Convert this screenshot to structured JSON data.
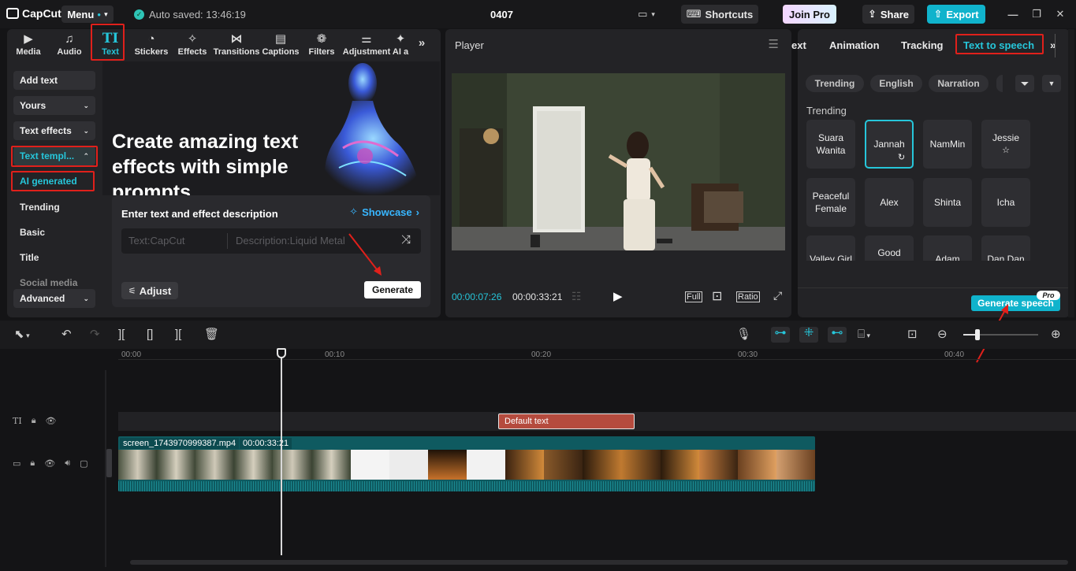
{
  "app": {
    "logo": "CapCut",
    "menu_label": "Menu",
    "saved_status": "Auto saved: 13:46:19",
    "project_title": "0407",
    "shortcuts_label": "Shortcuts",
    "join_pro_label": "Join Pro",
    "share_label": "Share",
    "export_label": "Export"
  },
  "toolbar": {
    "tools": [
      {
        "label": "Media",
        "icon": "media-icon"
      },
      {
        "label": "Audio",
        "icon": "audio-icon"
      },
      {
        "label": "Text",
        "icon": "text-icon"
      },
      {
        "label": "Stickers",
        "icon": "stickers-icon"
      },
      {
        "label": "Effects",
        "icon": "effects-icon"
      },
      {
        "label": "Transitions",
        "icon": "transitions-icon"
      },
      {
        "label": "Captions",
        "icon": "captions-icon"
      },
      {
        "label": "Filters",
        "icon": "filters-icon"
      },
      {
        "label": "Adjustment",
        "icon": "adjustment-icon"
      },
      {
        "label": "AI a",
        "icon": "ai-icon"
      }
    ],
    "active": "Text"
  },
  "sidebar": {
    "add_text": "Add text",
    "yours": "Yours",
    "text_effects": "Text effects",
    "text_templates": "Text templ...",
    "ai_generated": "AI generated",
    "items": [
      "Trending",
      "Basic",
      "Title",
      "Social media"
    ],
    "advanced": "Advanced"
  },
  "hero": {
    "headline": "Create amazing text effects with simple prompts"
  },
  "prompt": {
    "title": "Enter text and effect description",
    "showcase": "Showcase",
    "text_placeholder": "Text:CapCut",
    "desc_placeholder": "Description:Liquid Metal",
    "adjust": "Adjust",
    "generate": "Generate"
  },
  "player": {
    "title": "Player",
    "current_time": "00:00:07:26",
    "total_time": "00:00:33:21",
    "full": "Full",
    "ratio": "Ratio"
  },
  "right_panel": {
    "tabs": [
      "ext",
      "Animation",
      "Tracking",
      "Text to speech"
    ],
    "active_tab": "Text to speech",
    "filters": [
      "Trending",
      "English",
      "Narration"
    ],
    "section": "Trending",
    "voices": [
      "Suara Wanita",
      "Jannah",
      "NamMin",
      "Jessie",
      "Peaceful Female",
      "Alex",
      "Shinta",
      "Icha",
      "Valley Girl",
      "Good",
      "Adam",
      "Dan Dan"
    ],
    "selected_voice": "Jannah",
    "generate_speech": "Generate speech",
    "pro_badge": "Pro"
  },
  "timeline": {
    "ruler": [
      "00:00",
      "00:10",
      "00:20",
      "00:30",
      "00:40"
    ],
    "text_clip": "Default text",
    "video_file": "screen_1743970999387.mp4",
    "video_duration": "00:00:33:21"
  },
  "colors": {
    "accent": "#26c6da",
    "highlight_box": "#e0201b",
    "text_clip": "#b54b3e",
    "video_clip": "#0f5a60"
  }
}
